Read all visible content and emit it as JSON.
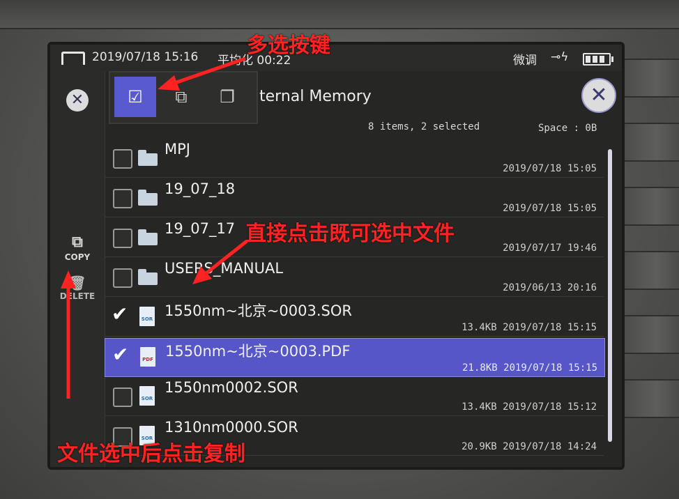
{
  "status_bar": {
    "date_time": "2019/07/18  15:16",
    "average": "平均化 00:22",
    "mode": "微调",
    "power_icon": "plug-icon",
    "battery_icon": "battery-icon"
  },
  "left_toolbar": {
    "close_icon": "close-icon",
    "copy_label": "COPY",
    "delete_label": "DELETE"
  },
  "selection_modes": [
    {
      "icon": "single-select-icon",
      "active": true
    },
    {
      "icon": "multi-select-icon",
      "active": false
    },
    {
      "icon": "select-all-icon",
      "active": false
    }
  ],
  "header": {
    "title": "ternal Memory",
    "summary": "8 items, 2 selected",
    "space": "Space : 0B"
  },
  "files": [
    {
      "name": "MPJ",
      "type": "folder",
      "size": "",
      "date": "2019/07/18 15:05",
      "checked": false,
      "highlighted": false
    },
    {
      "name": "19_07_18",
      "type": "folder",
      "size": "",
      "date": "2019/07/18 15:05",
      "checked": false,
      "highlighted": false
    },
    {
      "name": "19_07_17",
      "type": "folder",
      "size": "",
      "date": "2019/07/17 19:46",
      "checked": false,
      "highlighted": false
    },
    {
      "name": "USERS_MANUAL",
      "type": "folder",
      "size": "",
      "date": "2019/06/13 20:16",
      "checked": false,
      "highlighted": false
    },
    {
      "name": "1550nm~北京~0003.SOR",
      "type": "sor",
      "size": "13.4KB",
      "date": "2019/07/18 15:15",
      "checked": true,
      "highlighted": false
    },
    {
      "name": "1550nm~北京~0003.PDF",
      "type": "pdf",
      "size": "21.8KB",
      "date": "2019/07/18 15:15",
      "checked": true,
      "highlighted": true
    },
    {
      "name": "1550nm0002.SOR",
      "type": "sor",
      "size": "13.4KB",
      "date": "2019/07/18 15:12",
      "checked": false,
      "highlighted": false
    },
    {
      "name": "1310nm0000.SOR",
      "type": "sor",
      "size": "20.9KB",
      "date": "2019/07/18 14:24",
      "checked": false,
      "highlighted": false
    }
  ],
  "file_icon_labels": {
    "sor": "SOR",
    "pdf": "PDF"
  },
  "annotations": {
    "multi_select_key": "多选按键",
    "click_to_select": "直接点击既可选中文件",
    "copy_after_select": "文件选中后点击复制"
  },
  "colors": {
    "selection": "#5656c8",
    "annotation": "#ff2222"
  }
}
